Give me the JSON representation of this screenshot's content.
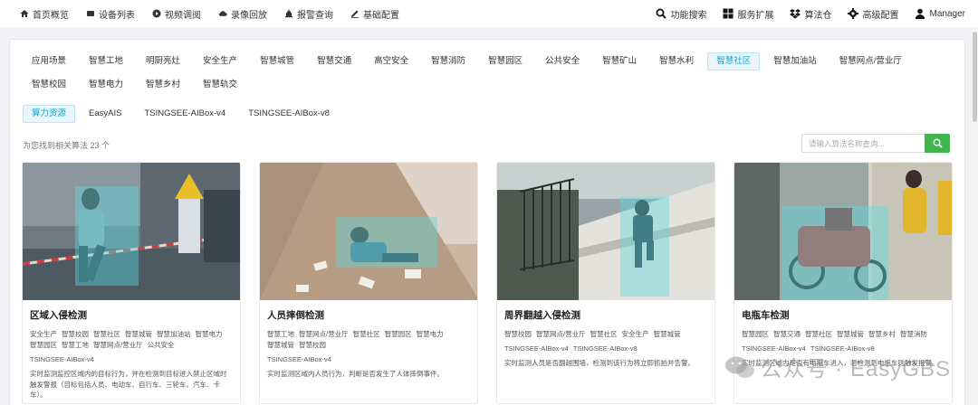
{
  "nav": {
    "left": [
      {
        "label": "首页概览",
        "icon": "home-icon"
      },
      {
        "label": "设备列表",
        "icon": "device-icon"
      },
      {
        "label": "视频调阅",
        "icon": "play-icon"
      },
      {
        "label": "录像回放",
        "icon": "cloud-icon"
      },
      {
        "label": "报警查询",
        "icon": "alarm-icon"
      },
      {
        "label": "基础配置",
        "icon": "edit-icon"
      }
    ],
    "right": [
      {
        "label": "功能搜索",
        "icon": "search-icon"
      },
      {
        "label": "服务扩展",
        "icon": "grid-icon"
      },
      {
        "label": "算法仓",
        "icon": "dropbox-icon"
      },
      {
        "label": "高级配置",
        "icon": "gear-icon"
      },
      {
        "label": "Manager",
        "icon": "user-icon"
      }
    ]
  },
  "categories": [
    "应用场景",
    "智慧工地",
    "明厨亮灶",
    "安全生产",
    "智慧城管",
    "智慧交通",
    "高空安全",
    "智慧消防",
    "智慧园区",
    "公共安全",
    "智慧矿山",
    "智慧水利",
    "智慧社区",
    "智慧加油站",
    "智慧网点/营业厅",
    "智慧校园",
    "智慧电力",
    "智慧乡村",
    "智慧轨交"
  ],
  "active_category": "智慧社区",
  "sources": [
    "算力资源",
    "EasyAIS",
    "TSINGSEE-AIBox-v4",
    "TSINGSEE-AIBox-v8"
  ],
  "active_source": "算力资源",
  "found_text": "为您找到相关算法 23 个",
  "search": {
    "placeholder": "请输入算法名称查询..."
  },
  "cards": [
    {
      "title": "区域入侵检测",
      "tags": [
        "安全生产",
        "智慧校园",
        "智慧社区",
        "智慧城管",
        "智慧加油站",
        "智慧电力",
        "智慧园区",
        "智慧工地",
        "智慧网点/营业厅",
        "公共安全"
      ],
      "boxes": [
        "TSINGSEE-AIBox-v4"
      ],
      "desc": "实时监测监控区域内的目标行为，并在检测到目标进入禁止区域时触发警报（目标包括人员、电动车、自行车、三轮车、汽车、卡车）。"
    },
    {
      "title": "人员摔倒检测",
      "tags": [
        "智慧工地",
        "智慧网点/营业厅",
        "智慧社区",
        "智慧园区",
        "智慧电力",
        "智慧城管",
        "智慧校园"
      ],
      "boxes": [
        "TSINGSEE-AIBox-v4"
      ],
      "desc": "实时监测区域内人员行为，判断是否发生了人体摔倒事件。"
    },
    {
      "title": "周界翻越入侵检测",
      "tags": [
        "智慧校园",
        "智慧网点/营业厅",
        "智慧社区",
        "安全生产",
        "智慧城管"
      ],
      "boxes": [
        "TSINGSEE-AIBox-v4",
        "TSINGSEE-AIBox-v8"
      ],
      "desc": "实时监测人员是否翻越围墙，检测到该行为将立即抓拍并告警。"
    },
    {
      "title": "电瓶车检测",
      "tags": [
        "智慧园区",
        "智慧交通",
        "智慧社区",
        "智慧城管",
        "智慧乡村",
        "智慧消防"
      ],
      "boxes": [
        "TSINGSEE-AIBox-v4",
        "TSINGSEE-AIBox-v8"
      ],
      "desc": "实时监测区域内是否有电瓶车进入，若检测到电瓶车则触发报警。"
    }
  ],
  "watermark": "公众号 · EasyGBS",
  "colors": {
    "accent": "#1aa3c8",
    "search_button": "#3fb54d",
    "detect_overlay": "#5adce1"
  }
}
